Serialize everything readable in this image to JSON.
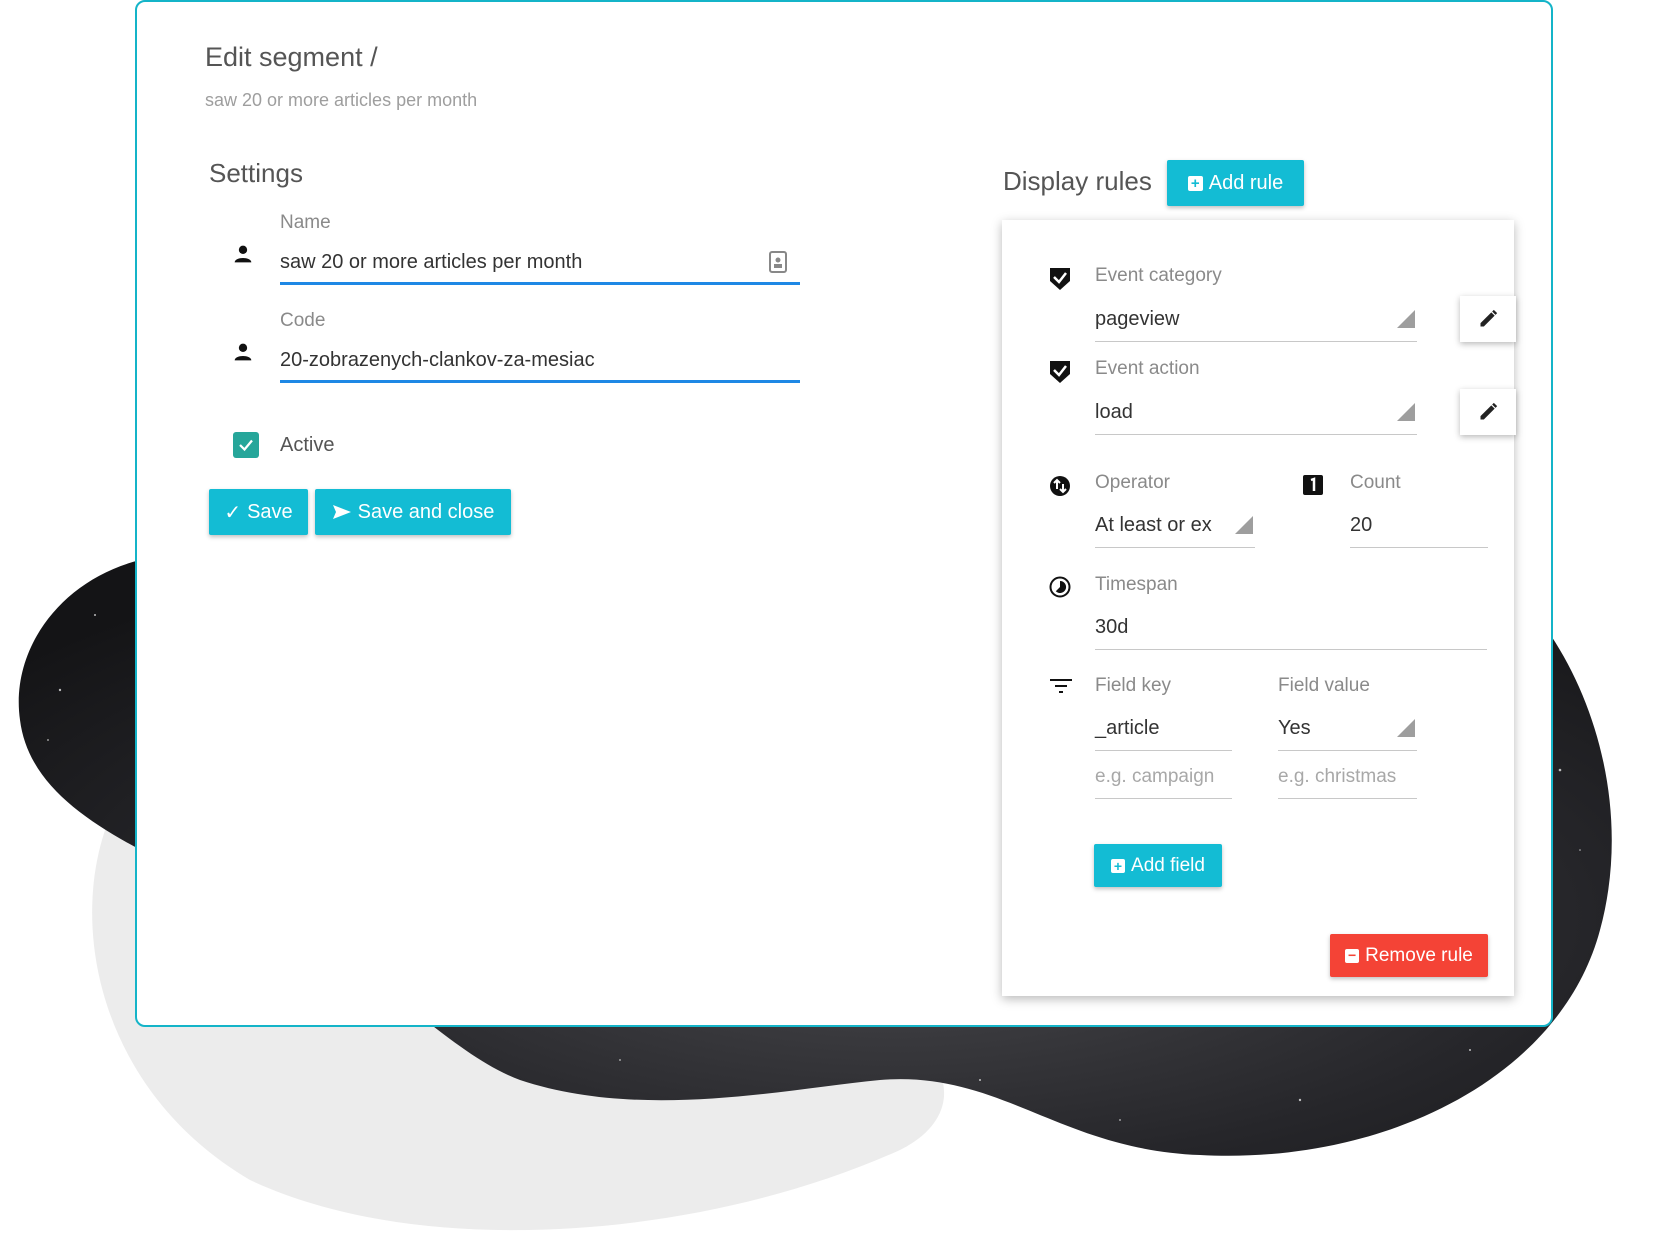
{
  "header": {
    "title": "Edit segment /",
    "subtitle": "saw 20 or more articles per month"
  },
  "settings": {
    "heading": "Settings",
    "name": {
      "label": "Name",
      "value": "saw 20 or more articles per month"
    },
    "code": {
      "label": "Code",
      "value": "20-zobrazenych-clankov-za-mesiac"
    },
    "active": {
      "label": "Active",
      "checked": true
    },
    "save_label": "Save",
    "save_close_label": "Save and close"
  },
  "rules": {
    "heading": "Display rules",
    "add_rule_label": "Add rule",
    "event_category": {
      "label": "Event category",
      "value": "pageview"
    },
    "event_action": {
      "label": "Event action",
      "value": "load"
    },
    "operator": {
      "label": "Operator",
      "value": "At least or ex"
    },
    "count": {
      "label": "Count",
      "value": "20"
    },
    "timespan": {
      "label": "Timespan",
      "value": "30d"
    },
    "fields": {
      "key_label": "Field key",
      "value_label": "Field value",
      "key_value": "_article",
      "value_value": "Yes",
      "key_placeholder": "e.g. campaign",
      "value_placeholder": "e.g. christmas"
    },
    "add_field_label": "Add field",
    "remove_rule_label": "Remove rule"
  },
  "colors": {
    "accent": "#13bcd4",
    "underline_active": "#1e88e5",
    "danger": "#f44336",
    "checkbox": "#26a69a"
  }
}
